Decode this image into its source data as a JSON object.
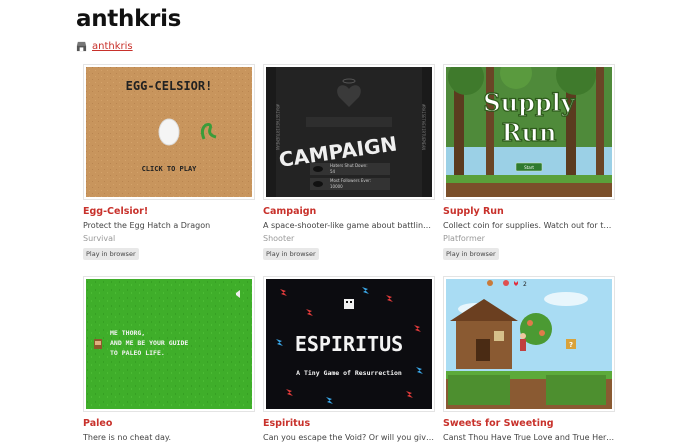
{
  "page": {
    "title": "anthkris"
  },
  "user": {
    "link": "anthkris"
  },
  "games": [
    {
      "title": "Egg-Celsior!",
      "description": "Protect the Egg Hatch a Dragon",
      "genre": "Survival",
      "platform": "Play in browser",
      "art": {
        "heading": "EGG-CELSIOR!",
        "caption": "CLICK TO PLAY"
      }
    },
    {
      "title": "Campaign",
      "description": "A space-shooter-like game about battling evil o...",
      "genre": "Shooter",
      "platform": "Play in browser",
      "art": {
        "heading": "CAMPAIGN",
        "side_text": "#RAISETHEVIRTUEMEAN",
        "row1": "Haters Shut Down:",
        "row1_value": "54",
        "row2": "Most Followers Ever:",
        "row2_value": "10000"
      }
    },
    {
      "title": "Supply Run",
      "description": "Collect coin for supplies. Watch out for those p...",
      "genre": "Platformer",
      "platform": "Play in browser",
      "art": {
        "heading_line1": "Supply",
        "heading_line2": "Run",
        "button": "Start"
      }
    },
    {
      "title": "Paleo",
      "description": "There is no cheat day.",
      "genre": "",
      "platform": "",
      "art": {
        "line1": "ME THORG,",
        "line2": "AND ME BE YOUR GUIDE",
        "line3": "TO PALEO LIFE."
      }
    },
    {
      "title": "Espiritus",
      "description": "Can you escape the Void? Or will you give in to ...",
      "genre": "",
      "platform": "",
      "art": {
        "heading": "ESPIRITUS",
        "subtitle": "A Tiny Game of Resurrection"
      }
    },
    {
      "title": "Sweets for Sweeting",
      "description": "Canst Thou Have True Love and True Heroism?",
      "genre": "",
      "platform": "",
      "art": {
        "hud_value": "2"
      }
    }
  ],
  "colors": {
    "accent": "#c8312b",
    "badge_bg": "#e8e8e8"
  }
}
